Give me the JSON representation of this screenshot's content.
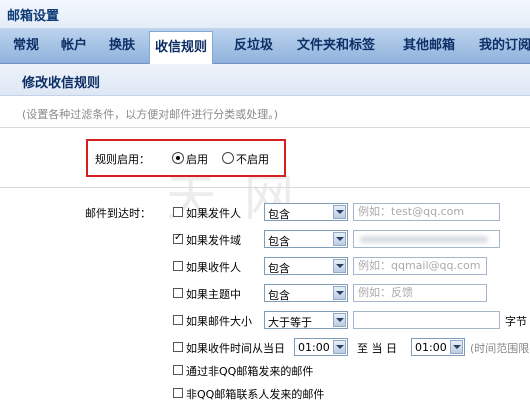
{
  "window": {
    "title": "邮箱设置"
  },
  "tabs": [
    {
      "label": "常规"
    },
    {
      "label": "帐户"
    },
    {
      "label": "换肤"
    },
    {
      "label": "收信规则",
      "active": true
    },
    {
      "label": "反垃圾"
    },
    {
      "label": "文件夹和标签"
    },
    {
      "label": "其他邮箱"
    },
    {
      "label": "我的订阅"
    }
  ],
  "section": {
    "title": "修改收信规则",
    "description": "(设置各种过滤条件，以方便对邮件进行分类或处理。)"
  },
  "rule_enable": {
    "label": "规则启用：",
    "options": [
      "启用",
      "不启用"
    ],
    "selected": "启用"
  },
  "conditions": {
    "label": "邮件到达时：",
    "rows": [
      {
        "label": "如果发件人",
        "checked": false,
        "operator": "包含",
        "placeholder": "例如：test@qq.com"
      },
      {
        "label": "如果发件域",
        "checked": true,
        "operator": "包含",
        "value_obscured": true
      },
      {
        "label": "如果收件人",
        "checked": false,
        "operator": "包含",
        "placeholder": "例如：qqmail@qq.com"
      },
      {
        "label": "如果主题中",
        "checked": false,
        "operator": "包含",
        "placeholder": "例如：反馈"
      },
      {
        "label": "如果邮件大小",
        "checked": false,
        "operator": "大于等于",
        "unit": "字节"
      }
    ],
    "time_row": {
      "label": "如果收件时间从当日",
      "checked": false,
      "from": "01:00",
      "to_label": "至 当 日",
      "to": "01:00",
      "note": "(时间范围限"
    },
    "extra": [
      {
        "label": "通过非QQ邮箱发来的邮件",
        "checked": false
      },
      {
        "label": "非QQ邮箱联系人发来的邮件",
        "checked": false
      }
    ]
  }
}
